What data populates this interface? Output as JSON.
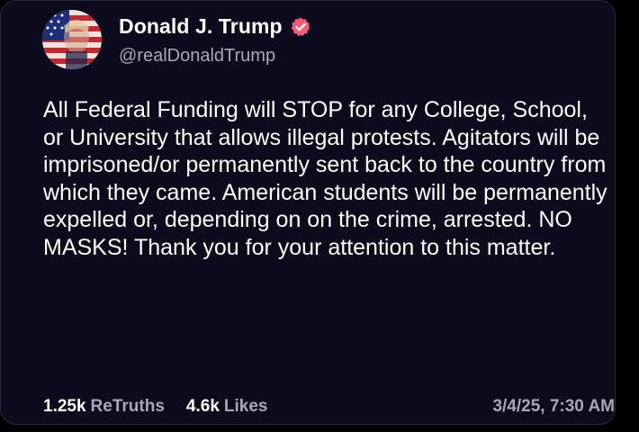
{
  "post": {
    "display_name": "Donald J. Trump",
    "handle": "@realDonaldTrump",
    "verified_icon": "verified-badge-icon",
    "avatar_icon": "flag-portrait-avatar",
    "text": "All Federal Funding will STOP for any College, School, or University that allows illegal protests. Agitators will be imprisoned/or permanently sent back to the country from which they came. American students will be permanently expelled or, depending on on the crime, arrested. NO MASKS! Thank you for your attention to this matter.",
    "retruths_count": "1.25k",
    "retruths_label": "ReTruths",
    "likes_count": "4.6k",
    "likes_label": "Likes",
    "timestamp": "3/4/25, 7:30 AM"
  },
  "colors": {
    "background": "#0c0a1d",
    "verified": "#f25c74",
    "muted_text": "#a9a7b5"
  }
}
